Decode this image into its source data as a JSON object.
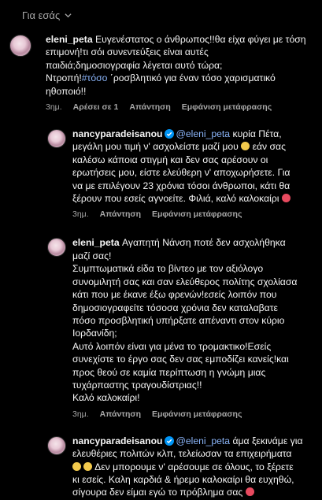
{
  "header": {
    "label": "Για εσάς"
  },
  "comments": [
    {
      "username": "eleni_peta",
      "text_lines": [
        "Ευγενέστατος ο άνθρωπος!!θα είχα φύγει με τόση",
        "επιμονή!τι σόι συνεντεύξεις είναι αυτές",
        "παιδιά;δημοσιογραφία λέγεται αυτό τώρα;",
        "!#τόσο ΄ροσβλητικό για έναν τόσο χαρισματικό",
        "ηθοποιό!!"
      ],
      "line4_prefix": "Ντροπή!",
      "hashtag": "#τόσο",
      "line4_rest": " ΄ροσβλητικό για έναν τόσο χαρισματικό",
      "time": "3ημ.",
      "likes": "Αρέσει σε 1",
      "reply": "Απάντηση",
      "translate": "Εμφάνιση μετάφρασης"
    },
    {
      "username": "nancyparadeisanou",
      "mention": "@eleni_peta",
      "text_lines": [
        " κυρία Πέτα,",
        "μεγάλη μου τιμή ν' ασχολείστε μαζί μου",
        " εάν σας",
        "καλέσω κάποια στιγμή και δεν σας αρέσουν οι",
        "ερωτήσεις μου, είστε ελεύθερη ν' αποχωρήσετε. Για",
        "να με επιλέγουν 23 χρόνια τόσοι άνθρωποι, κάτι θα",
        "ξέρουν που εσείς αγνοείτε. Φιλιά, καλό καλοκαίρι"
      ],
      "time": "3ημ.",
      "reply": "Απάντηση",
      "translate": "Εμφάνιση μετάφρασης"
    },
    {
      "username": "eleni_peta",
      "text_lines": [
        " Αγαπητή Νάνση ποτέ δεν ασχολήθηκα",
        "μαζί σας!",
        "Συμπτωματικά είδα το βίντεο με τον αξιόλογο",
        "συνομιλητή σας και σαν ελεύθερος πολίτης σχολίασα",
        "κάτι που με έκανε έξω φρενών!εσείς λοιπόν που",
        "δημοσιογραφείτε τόσοσα χρόνια δεν καταλαβατε",
        "πόσο προσβλητική υπήρξατε απέναντι στον κύριο",
        "Ιορδανίδη;",
        "Αυτό λοιπόν είναι για μένα το τρομακτικο!Εσείς",
        "συνεχίστε το έργο σας δεν σας εμποδίζει κανείς!και",
        "προς θεού σε καμία περίπτωση η γνώμη μιας",
        "τυχάρπαστης τραγουδίστριας!!",
        "Καλό καλοκαίρι!"
      ],
      "time": "3ημ.",
      "reply": "Απάντηση",
      "translate": "Εμφάνιση μετάφρασης"
    },
    {
      "username": "nancyparadeisanou",
      "mention": "@eleni_peta",
      "text_lines": [
        " άμα ξεκινάμε για",
        "ελευθέριες πολιτών κλπ, τελείωσαν τα επιχειρήματα",
        " Δεν μπορουμε ν' αρέσουμε σε όλους, το ξέρετε",
        "κι εσείς. Καλη καρδιά & ήρεμο καλοκαίρι θα ευχηθώ,",
        "σίγουρα δεν είμαι εγώ το πρόβλημα σας"
      ]
    }
  ],
  "colors": {
    "background": "#000000",
    "text": "#f5f5f5",
    "meta": "#a8a8a8",
    "link": "#8ab4f8",
    "verified": "#0095f6"
  }
}
